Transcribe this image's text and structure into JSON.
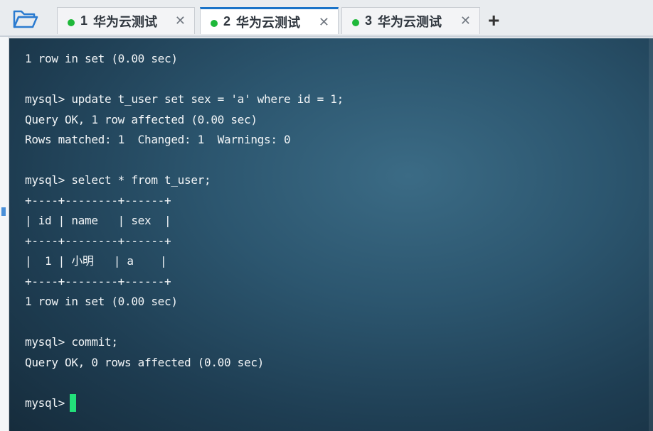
{
  "tabs": [
    {
      "num": "1",
      "title": "华为云测试",
      "active": false,
      "status_color": "#1fb83a"
    },
    {
      "num": "2",
      "title": "华为云测试",
      "active": true,
      "status_color": "#1fb83a"
    },
    {
      "num": "3",
      "title": "华为云测试",
      "active": false,
      "status_color": "#1fb83a"
    }
  ],
  "icons": {
    "folder": "folder-icon",
    "close": "close-icon",
    "add": "plus-icon",
    "close_glyph": "✕",
    "add_glyph": "+"
  },
  "terminal": {
    "lines": [
      "1 row in set (0.00 sec)",
      "",
      "mysql> update t_user set sex = 'a' where id = 1;",
      "Query OK, 1 row affected (0.00 sec)",
      "Rows matched: 1  Changed: 1  Warnings: 0",
      "",
      "mysql> select * from t_user;",
      "+----+--------+------+",
      "| id | name   | sex  |",
      "+----+--------+------+",
      "|  1 | 小明   | a    |",
      "+----+--------+------+",
      "1 row in set (0.00 sec)",
      "",
      "mysql> commit;",
      "Query OK, 0 rows affected (0.00 sec)",
      "",
      "mysql> "
    ],
    "cursor_color": "#22e07a"
  }
}
